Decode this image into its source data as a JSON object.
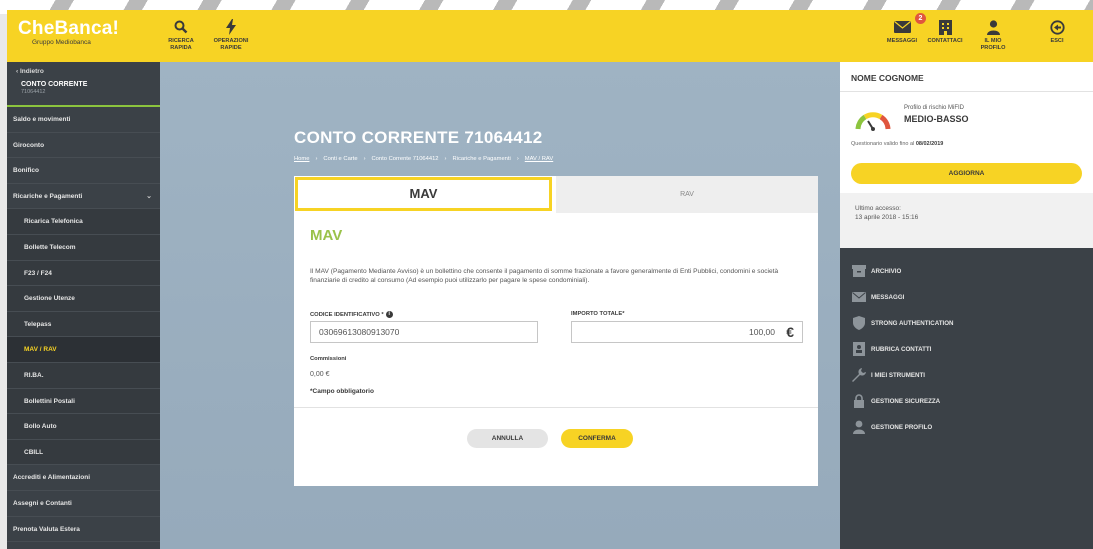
{
  "brand": {
    "name": "CheBanca!",
    "subtitle": "Gruppo Mediobanca"
  },
  "topbar": {
    "left_actions": [
      {
        "label": "RICERCA\nRAPIDA",
        "icon": "search-icon"
      },
      {
        "label": "OPERAZIONI\nRAPIDE",
        "icon": "lightning-icon"
      }
    ],
    "right_actions": [
      {
        "label": "MESSAGGI",
        "icon": "envelope-icon",
        "badge": "2"
      },
      {
        "label": "CONTATTACI",
        "icon": "building-icon"
      },
      {
        "label": "IL MIO\nPROFILO",
        "icon": "user-icon"
      },
      {
        "label": "ESCI",
        "icon": "logout-icon"
      }
    ]
  },
  "sidebar": {
    "back_label": "‹  Indietro",
    "section_title": "CONTO CORRENTE",
    "section_sub": "71064412",
    "items": [
      {
        "label": "Saldo e movimenti",
        "sub": false
      },
      {
        "label": "Giroconto",
        "sub": false
      },
      {
        "label": "Bonifico",
        "sub": false
      },
      {
        "label": "Ricariche e Pagamenti",
        "sub": false,
        "expanded": true
      },
      {
        "label": "Ricarica Telefonica",
        "sub": true
      },
      {
        "label": "Bollette Telecom",
        "sub": true
      },
      {
        "label": "F23 / F24",
        "sub": true
      },
      {
        "label": "Gestione Utenze",
        "sub": true
      },
      {
        "label": "Telepass",
        "sub": true
      },
      {
        "label": "MAV / RAV",
        "sub": true,
        "active": true
      },
      {
        "label": "RI.BA.",
        "sub": true
      },
      {
        "label": "Bollettini Postali",
        "sub": true
      },
      {
        "label": "Bollo Auto",
        "sub": true
      },
      {
        "label": "CBILL",
        "sub": true
      },
      {
        "label": "Accrediti e Alimentazioni",
        "sub": false
      },
      {
        "label": "Assegni e Contanti",
        "sub": false
      },
      {
        "label": "Prenota Valuta Estera",
        "sub": false
      }
    ]
  },
  "main": {
    "title": "CONTO CORRENTE 71064412",
    "breadcrumb": [
      "Home",
      "Conti e Carte",
      "Conto Corrente 71064412",
      "Ricariche e Pagamenti",
      "MAV / RAV"
    ],
    "tabs": [
      {
        "label": "MAV",
        "active": true
      },
      {
        "label": "RAV",
        "active": false
      }
    ],
    "section_title": "MAV",
    "description": "Il MAV (Pagamento Mediante Avviso) è un bollettino che consente il pagamento di somme frazionate a favore generalmente di Enti Pubblici, condomini e società finanziarie di credito al consumo (Ad esempio puoi utilizzarlo per pagare le spese condominiali).",
    "form": {
      "code_label": "CODICE IDENTIFICATIVO *",
      "code_value": "03069613080913070",
      "amount_label": "IMPORTO TOTALE*",
      "amount_value": "100,00",
      "currency_symbol": "€",
      "commission_label": "Commissioni",
      "commission_value": "0,00 €",
      "required_note": "*Campo obbligatorio"
    },
    "buttons": {
      "cancel": "ANNULLA",
      "confirm": "CONFERMA"
    }
  },
  "profile": {
    "name": "NOME COGNOME",
    "risk_label": "Profilo di rischio MiFID",
    "risk_value": "MEDIO-BASSO",
    "questionnaire_text": "Questionario valido fino al ",
    "questionnaire_date": "08/02/2019",
    "update_button": "AGGIORNA",
    "last_access_label": "Ultimo accesso:",
    "last_access_value": "13 aprile 2018 - 15:16",
    "menu": [
      {
        "label": "ARCHIVIO",
        "icon": "archive-icon"
      },
      {
        "label": "MESSAGGI",
        "icon": "envelope-icon"
      },
      {
        "label": "STRONG AUTHENTICATION",
        "icon": "shield-icon"
      },
      {
        "label": "RUBRICA CONTATTI",
        "icon": "address-book-icon"
      },
      {
        "label": "I MIEI STRUMENTI",
        "icon": "wrench-icon"
      },
      {
        "label": "GESTIONE SICUREZZA",
        "icon": "lock-icon"
      },
      {
        "label": "GESTIONE PROFILO",
        "icon": "user-icon"
      }
    ]
  },
  "colors": {
    "brand_yellow": "#f7d324",
    "accent_green": "#9ac24a",
    "sidebar_dark": "#3b4147",
    "content_blue": "#9fb3c3"
  }
}
